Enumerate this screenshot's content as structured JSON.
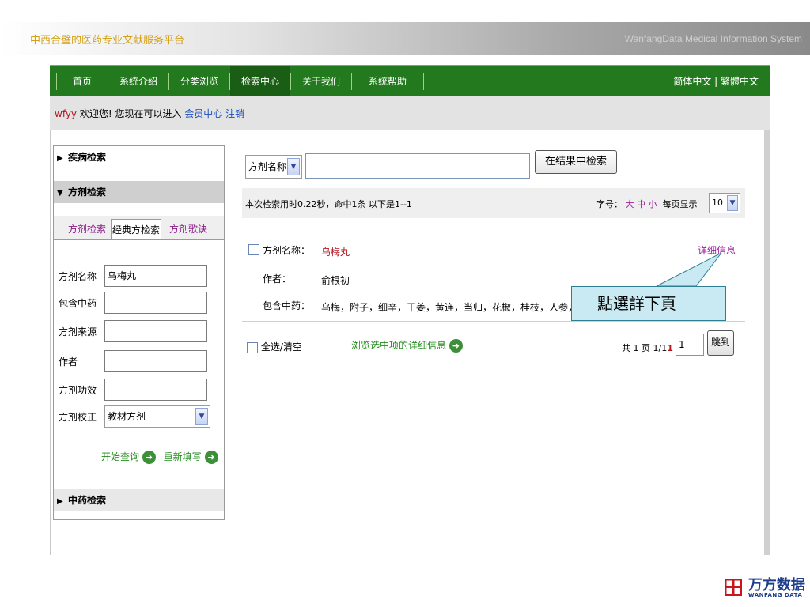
{
  "banner": {
    "title": "中西合璧的医药专业文献服务平台",
    "subtitle_en": "WanfangData Medical Information System"
  },
  "nav": {
    "items": [
      "首页",
      "系统介绍",
      "分类浏览",
      "检索中心",
      "关于我们",
      "系统帮助"
    ],
    "active": "检索中心",
    "language": "简体中文 | 繁體中文",
    "bg_color": "#237a1e"
  },
  "welcome": {
    "user": "wfyy",
    "greeting": " 欢迎您! 您现在可以进入 ",
    "member_center": "会员中心",
    "logout": "注销"
  },
  "sidebar": {
    "disease_search": "疾病检索",
    "formula_search": "方剂检索",
    "tabs": [
      "方剂检索",
      "经典方检索",
      "方剂歌诀"
    ],
    "active_tab": "经典方检索",
    "fields": [
      {
        "label": "方剂名称",
        "value": "乌梅丸"
      },
      {
        "label": "包含中药",
        "value": ""
      },
      {
        "label": "方剂来源",
        "value": ""
      },
      {
        "label": "作者",
        "value": ""
      },
      {
        "label": "方剂功效",
        "value": ""
      },
      {
        "label": "方剂校正",
        "value": "教材方剂"
      }
    ],
    "start_query": "开始查询",
    "reset": "重新填写",
    "herb_search": "中药检索"
  },
  "search": {
    "field_select": "方剂名称",
    "keyword": "",
    "search_in_results": "在结果中检索"
  },
  "result_bar": {
    "stats": "本次检索用时0.22秒，命中1条 以下是1--1",
    "font_size_label": "字号：",
    "font_sizes": [
      "大",
      "中",
      "小"
    ],
    "per_page_label": "每页显示",
    "per_page": "10"
  },
  "result": {
    "name_label": "方剂名称：",
    "name": "乌梅丸",
    "detail_link": "详细信息",
    "author_label": "作者：",
    "author": "俞根初",
    "herbs_label": "包含中药：",
    "herbs": "乌梅，附子，细辛，干姜，黄连，当归，花椒，桂枝，人参，黄柏"
  },
  "callout": "點選詳下頁",
  "bulk": {
    "select_all": "全选/清空",
    "browse_selected": "浏览选中项的详细信息"
  },
  "pager": {
    "summary_prefix": "共 1 页 1/1",
    "current": "1",
    "input": "1",
    "jump": "跳到"
  },
  "logo": {
    "cn": "万方数据",
    "en": "WANFANG DATA",
    "color": "#c8161d"
  }
}
